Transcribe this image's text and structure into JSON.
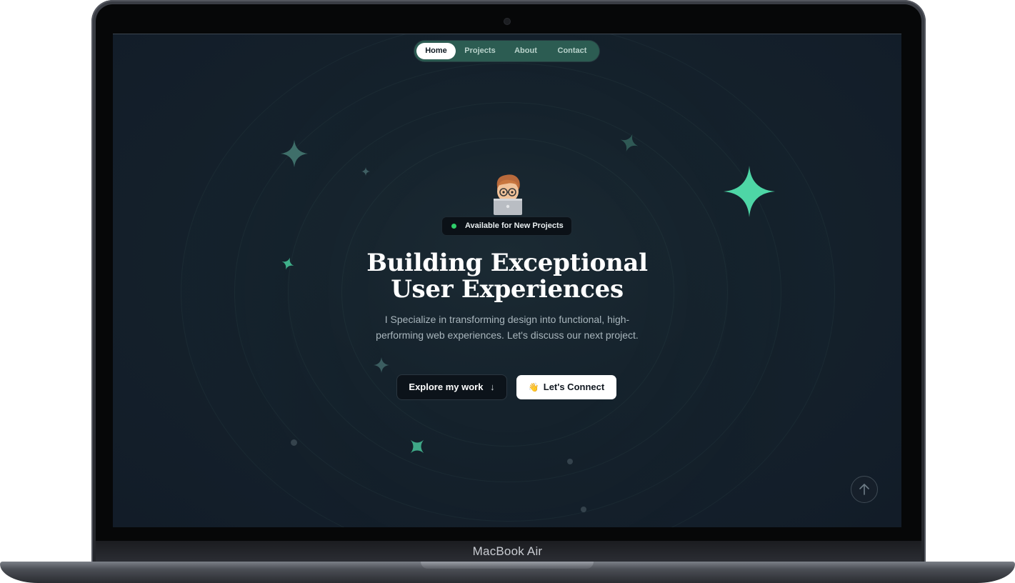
{
  "device": {
    "label": "MacBook Air"
  },
  "nav": {
    "items": [
      {
        "label": "Home",
        "active": true
      },
      {
        "label": "Projects",
        "active": false
      },
      {
        "label": "About",
        "active": false
      },
      {
        "label": "Contact",
        "active": false
      }
    ]
  },
  "hero": {
    "badge": "Available for New Projects",
    "title_line1": "Building Exceptional",
    "title_line2": "User Experiences",
    "subtitle": "I Specialize in transforming design into functional, high-performing web experiences. Let's discuss our next project.",
    "primary_button": "Explore my work",
    "primary_button_icon": "↓",
    "secondary_button": "Let's Connect",
    "secondary_button_icon": "👋"
  },
  "colors": {
    "background": "#121c28",
    "nav_bg": "#2c5c52",
    "accent_green": "#4ed6a6",
    "status_dot": "#2fce6a"
  },
  "icons": [
    "sparkle-star-icon",
    "arrow-down-icon",
    "wave-hand-icon",
    "arrow-up-icon",
    "status-dot-icon",
    "memoji-avatar-icon"
  ]
}
